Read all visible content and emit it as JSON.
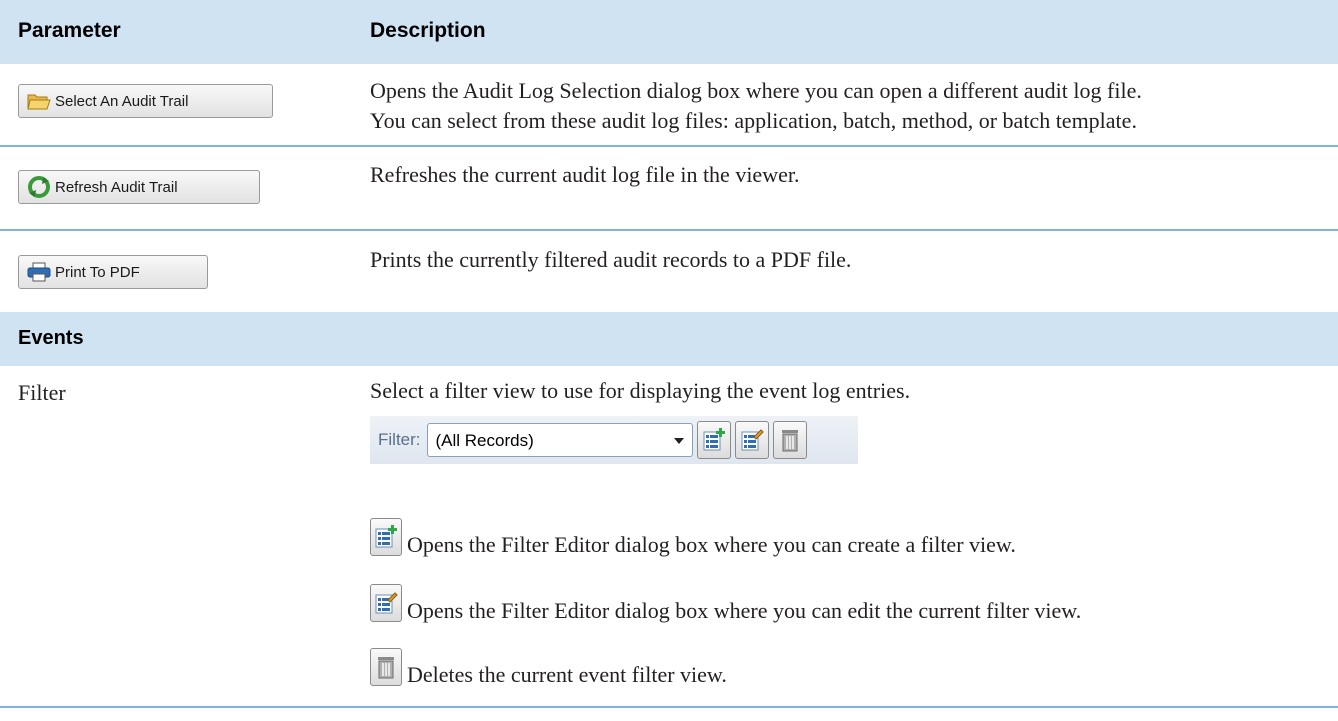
{
  "header": {
    "parameter": "Parameter",
    "description": "Description"
  },
  "rows": [
    {
      "button_label": "Select An Audit Trail",
      "icon": "folder-open-icon",
      "description_lines": [
        "Opens the Audit Log Selection dialog box where you can open a different audit log file.",
        "You can select from these audit log files: application, batch, method, or batch template."
      ]
    },
    {
      "button_label": "Refresh Audit Trail",
      "icon": "refresh-icon",
      "description_lines": [
        "Refreshes the current audit log file in the viewer."
      ]
    },
    {
      "button_label": "Print To PDF",
      "icon": "printer-icon",
      "description_lines": [
        "Prints the currently filtered audit records to a PDF file."
      ]
    }
  ],
  "events_section": {
    "title": "Events",
    "filter_row": {
      "parameter": "Filter",
      "description": "Select a filter view to use for displaying the event log entries.",
      "toolbar": {
        "label": "Filter:",
        "selected": "(All Records)"
      },
      "icon_items": [
        {
          "icon": "new-filter-icon",
          "text": "Opens the Filter Editor dialog box where you can create a filter view."
        },
        {
          "icon": "edit-filter-icon",
          "text": "Opens the Filter Editor dialog box where you can edit the current filter view."
        },
        {
          "icon": "delete-filter-icon",
          "text": "Deletes the current event filter view."
        }
      ]
    }
  },
  "colors": {
    "header_bg": "#cfe3f3",
    "rule": "#7fb3dc"
  }
}
